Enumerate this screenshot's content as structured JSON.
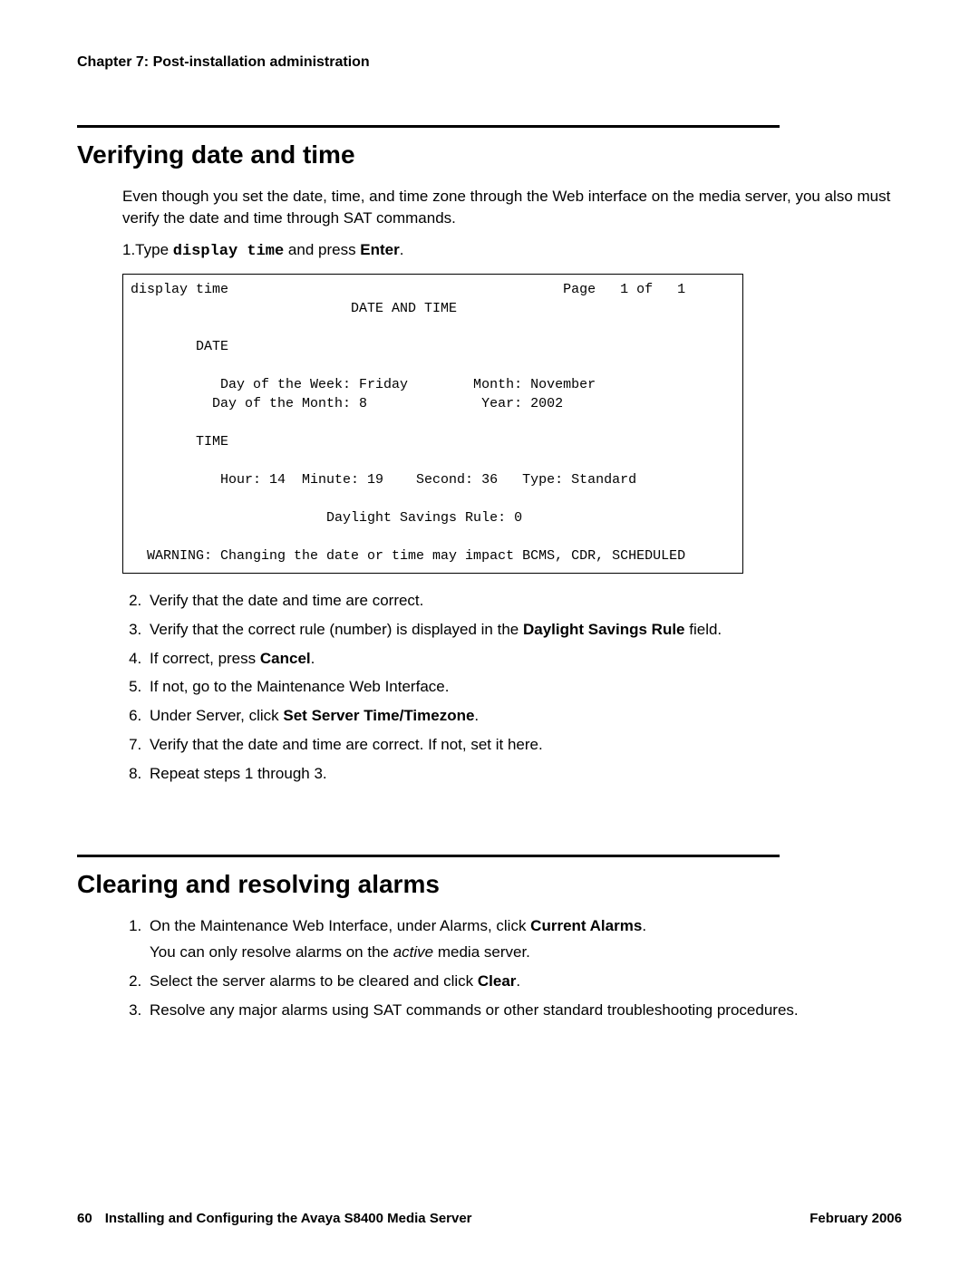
{
  "header": {
    "chapter": "Chapter 7: Post-installation administration"
  },
  "section1": {
    "title": "Verifying date and time",
    "intro": "Even though you set the date, time, and time zone through the Web interface on the media server, you also must verify the date and time through SAT commands.",
    "step1_prefix": "1.Type ",
    "step1_cmd": "display time",
    "step1_suffix": " and press ",
    "step1_key": "Enter",
    "step1_end": ".",
    "terminal": "display time                                         Page   1 of   1\n                           DATE AND TIME\n\n        DATE\n\n           Day of the Week: Friday        Month: November\n          Day of the Month: 8              Year: 2002\n\n        TIME\n\n           Hour: 14  Minute: 19    Second: 36   Type: Standard\n\n                        Daylight Savings Rule: 0\n\n  WARNING: Changing the date or time may impact BCMS, CDR, SCHEDULED",
    "steps": {
      "s2": "Verify that the date and time are correct.",
      "s3_a": "Verify that the correct rule (number) is displayed in the ",
      "s3_b": "Daylight Savings Rule",
      "s3_c": " field.",
      "s4_a": "If correct, press ",
      "s4_b": "Cancel",
      "s4_c": ".",
      "s5": "If not, go to the Maintenance Web Interface.",
      "s6_a": "Under Server, click ",
      "s6_b": "Set Server Time/Timezone",
      "s6_c": ".",
      "s7": "Verify that the date and time are correct. If not, set it here.",
      "s8": "Repeat steps 1 through 3."
    }
  },
  "section2": {
    "title": "Clearing and resolving alarms",
    "steps": {
      "s1_a": "On the Maintenance Web Interface, under Alarms, click ",
      "s1_b": "Current Alarms",
      "s1_c": ".",
      "s1_sub_a": "You can only resolve alarms on the ",
      "s1_sub_b": "active",
      "s1_sub_c": " media server.",
      "s2_a": "Select the server alarms to be cleared and click ",
      "s2_b": "Clear",
      "s2_c": ".",
      "s3": "Resolve any major alarms using SAT commands or other standard troubleshooting procedures."
    }
  },
  "footer": {
    "page_number": "60",
    "doc_title": "Installing and Configuring the Avaya S8400 Media Server",
    "date": "February 2006"
  }
}
